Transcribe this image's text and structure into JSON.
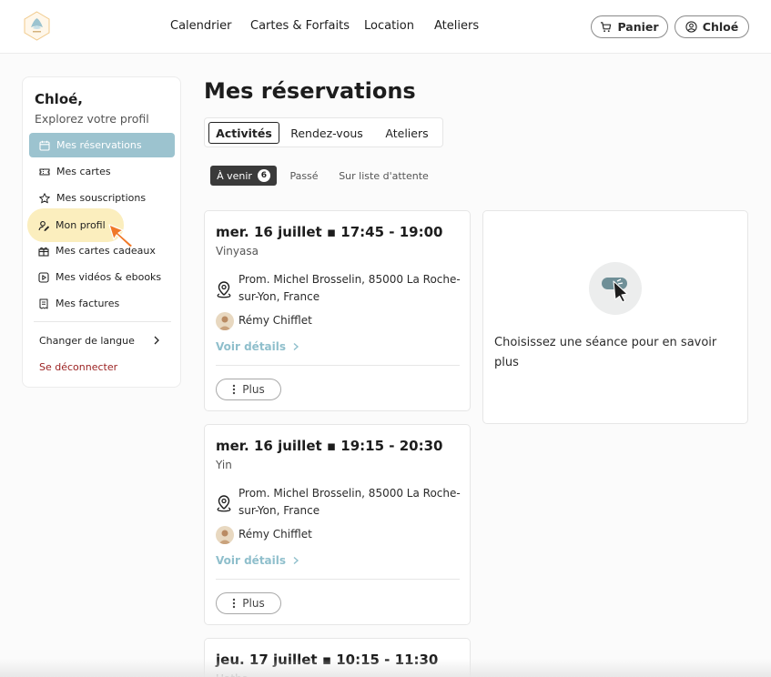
{
  "header": {
    "nav": [
      "Calendrier",
      "Cartes & Forfaits",
      "Location",
      "Ateliers"
    ],
    "cart_label": "Panier",
    "user_label": "Chloé",
    "logo_icon": "studio-logo-icon"
  },
  "sidebar": {
    "greeting": "Chloé,",
    "subtitle": "Explorez votre profil",
    "items": [
      {
        "label": "Mes réservations",
        "icon": "calendar-icon",
        "active": true
      },
      {
        "label": "Mes cartes",
        "icon": "ticket-icon"
      },
      {
        "label": "Mes souscriptions",
        "icon": "star-icon"
      },
      {
        "label": "Mon profil",
        "icon": "user-edit-icon"
      },
      {
        "label": "Mes cartes cadeaux",
        "icon": "gift-icon"
      },
      {
        "label": "Mes vidéos & ebooks",
        "icon": "play-icon"
      },
      {
        "label": "Mes factures",
        "icon": "invoice-icon"
      }
    ],
    "language": "Changer de langue",
    "logout": "Se déconnecter"
  },
  "main": {
    "title": "Mes réservations",
    "tabs": [
      "Activités",
      "Rendez-vous",
      "Ateliers"
    ],
    "subtabs": {
      "upcoming": "À venir",
      "upcoming_count": "6",
      "past": "Passé",
      "waitlist": "Sur liste d'attente"
    },
    "bookings": [
      {
        "date": "mer. 16 juillet ▪ 17:45 - 19:00",
        "class": "Vinyasa",
        "location": "Prom. Michel Brosselin, 85000 La Roche-sur-Yon, France",
        "teacher": "Rémy Chifflet",
        "details": "Voir détails",
        "more": "Plus"
      },
      {
        "date": "mer. 16 juillet ▪ 19:15 - 20:30",
        "class": "Yin",
        "location": "Prom. Michel Brosselin, 85000 La Roche-sur-Yon, France",
        "teacher": "Rémy Chifflet",
        "details": "Voir détails",
        "more": "Plus"
      },
      {
        "date": "jeu. 17 juillet ▪ 10:15 - 11:30",
        "class": "Hatha"
      }
    ],
    "info_panel": {
      "text": "Choisissez une séance pour en savoir plus",
      "icon": "cursor-click-icon"
    }
  },
  "colors": {
    "accent": "#9cc3cf",
    "link": "#8fbfcc",
    "highlight": "#fbeebe",
    "logout": "#9a1f1f",
    "cursor": "#f07828"
  }
}
